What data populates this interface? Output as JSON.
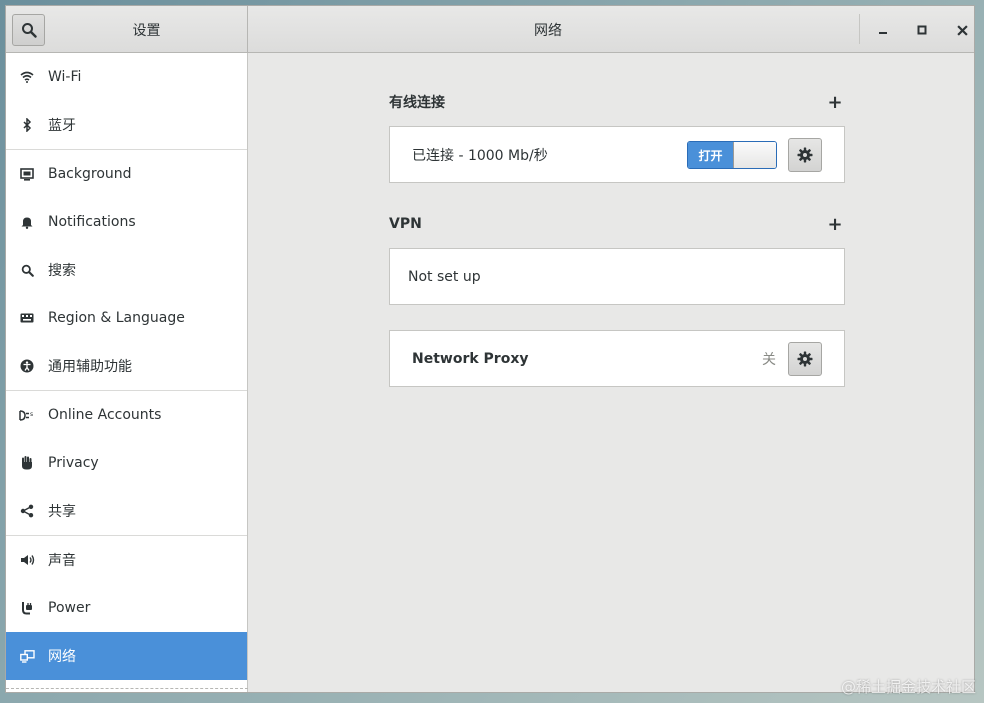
{
  "sidebar_title": "设置",
  "main_title": "网络",
  "window_controls": {
    "minimize": "–",
    "maximize": "□",
    "close": "✕"
  },
  "sidebar": {
    "items": [
      {
        "label": "Wi-Fi",
        "icon": "wifi-icon"
      },
      {
        "label": "蓝牙",
        "icon": "bluetooth-icon"
      },
      {
        "label": "Background",
        "icon": "background-icon"
      },
      {
        "label": "Notifications",
        "icon": "bell-icon"
      },
      {
        "label": "搜索",
        "icon": "search-icon"
      },
      {
        "label": "Region & Language",
        "icon": "keyboard-icon"
      },
      {
        "label": "通用辅助功能",
        "icon": "accessibility-icon"
      },
      {
        "label": "Online Accounts",
        "icon": "online-accounts-icon"
      },
      {
        "label": "Privacy",
        "icon": "hand-icon"
      },
      {
        "label": "共享",
        "icon": "share-icon"
      },
      {
        "label": "声音",
        "icon": "speaker-icon"
      },
      {
        "label": "Power",
        "icon": "power-icon"
      },
      {
        "label": "网络",
        "icon": "network-icon",
        "selected": true
      }
    ]
  },
  "wired": {
    "heading": "有线连接",
    "add": "+",
    "status": "已连接 - 1000 Mb/秒",
    "switch_label": "打开",
    "switch_on": true
  },
  "vpn": {
    "heading": "VPN",
    "add": "+",
    "status": "Not set up"
  },
  "proxy": {
    "label": "Network Proxy",
    "state": "关"
  },
  "watermark": "@稀土掘金技术社区",
  "colors": {
    "accent": "#4a90d9",
    "window_bg": "#e8e8e7",
    "sidebar_bg": "#ffffff"
  }
}
